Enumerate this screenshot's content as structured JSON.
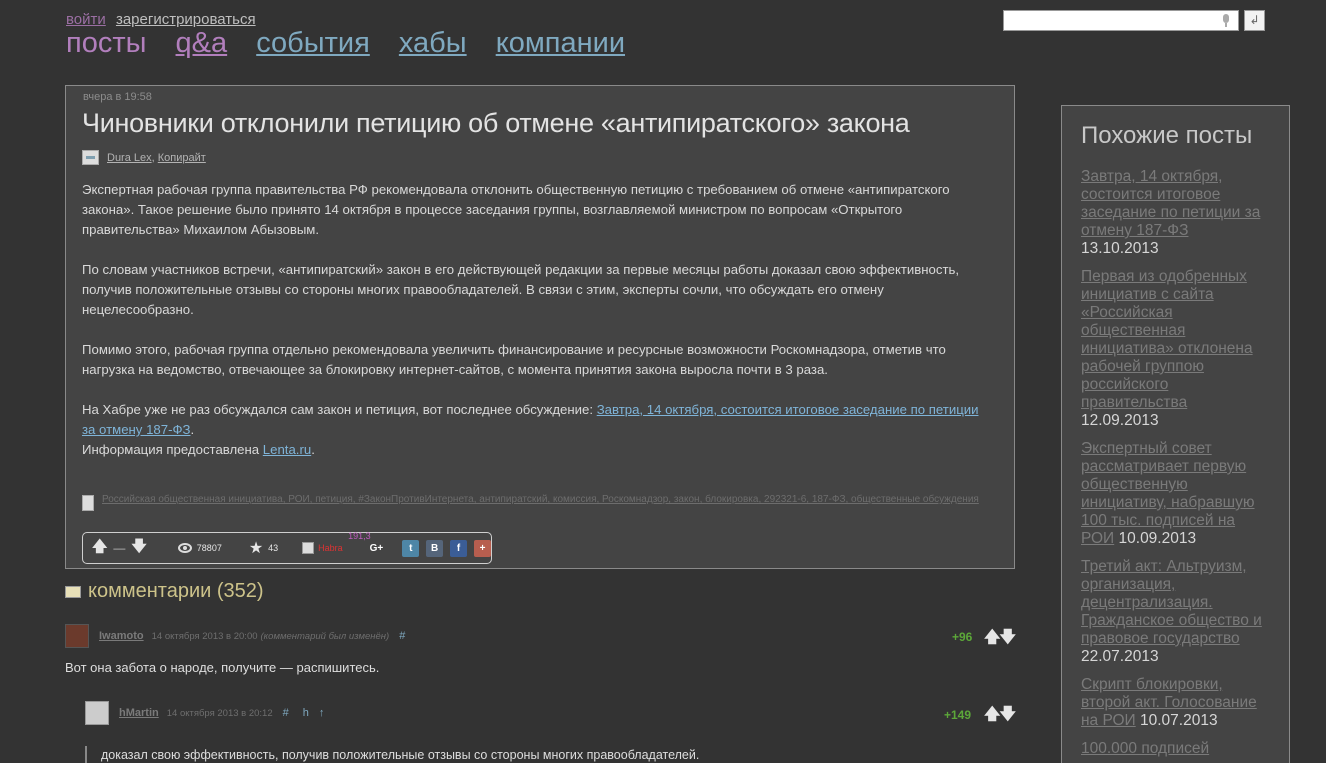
{
  "header": {
    "login": "войти",
    "register": "зарегистрироваться",
    "nav": [
      "посты",
      "q&a",
      "события",
      "хабы",
      "компании"
    ],
    "search_placeholder": "",
    "search_button": "↲"
  },
  "post": {
    "date": "вчера в 19:58",
    "title": "Чиновники отклонили петицию об отмене «антипиратского» закона",
    "hubs": [
      "Dura Lex",
      "Копирайт"
    ],
    "paragraphs": [
      "Экспертная рабочая группа правительства РФ рекомендовала отклонить общественную петицию с требованием об отмене «антипиратского закона». Такое решение было принято 14 октября в процессе заседания группы, возглавляемой министром по вопросам «Открытого правительства» Михаилом Абызовым.",
      "По словам участников встречи, «антипиратский» закон в его действующей редакции за первые месяцы работы доказал свою эффективность, получив положительные отзывы со стороны многих правообладателей. В связи с этим, эксперты сочли, что обсуждать его отмену нецелесообразно.",
      "Помимо этого, рабочая группа отдельно рекомендовала увеличить финансирование и ресурсные возможности Роскомнадзора, отметив что нагрузка на ведомство, отвечающее за блокировку интернет-сайтов, с момента принятия закона выросла почти в 3 раза."
    ],
    "last_text": "На Хабре уже не раз обсуждался сам закон и петиция, вот последнее обсуждение: ",
    "last_link": "Завтра, 14 октября, состоится итоговое заседание по петиции за отмену 187-ФЗ",
    "last_dot": ".",
    "info_text": "Информация предоставлена ",
    "info_link": "Lenta.ru",
    "info_dot": ".",
    "tags": "Российская общественная инициатива, РОИ, петиция, #ЗаконПротивИнтернета, антипиратский, комиссия, Роскомнадзор, закон, блокировка, 292321-6, 187-ФЗ, общественные обсуждения",
    "infobar": {
      "vote_up": "🡅",
      "vote_score": "—",
      "vote_down": "🡇",
      "views": "78807",
      "favorites": "43",
      "habra": "Habra",
      "karma": "191,3",
      "gplus": "G+",
      "share_tw": "t",
      "share_vk": "В",
      "share_fb": "f",
      "share_plus": "+"
    }
  },
  "comments": {
    "title": "комментарии (352)",
    "items": [
      {
        "user": "Iwamoto",
        "date": "14 октября 2013 в 20:00",
        "edited": "(комментарий был изменён)",
        "hash": "#",
        "score": "+96",
        "text": "Вот она забота о народе, получите — распишитесь."
      },
      {
        "user": "hMartin",
        "date": "14 октября 2013 в 20:12",
        "hash": "#",
        "parent": "h",
        "up": "↑",
        "score": "+149",
        "quote": "доказал свою эффективность, получив положительные отзывы со стороны многих правообладателей."
      }
    ],
    "arrows": "🡅🡇"
  },
  "sidebar": {
    "title": "Похожие посты",
    "items": [
      {
        "link": "Завтра, 14 октября, состоится итоговое заседание по петиции за отмену 187-ФЗ",
        "date": "13.10.2013"
      },
      {
        "link": "Первая из одобренных инициатив с сайта «Российская общественная инициатива» отклонена рабочей группою российского правительства",
        "date": "12.09.2013"
      },
      {
        "link": "Экспертный совет рассматривает первую общественную инициативу, набравшую 100 тыс. подписей на РОИ",
        "date": "10.09.2013"
      },
      {
        "link": "Третий акт: Альтруизм, организация, децентрализация. Гражданское общество и правовое государство",
        "date": "22.07.2013"
      },
      {
        "link": "Скрипт блокировки, второй акт. Голосование на РОИ",
        "date": "10.07.2013"
      },
      {
        "link": "100.000 подписей",
        "date": ""
      }
    ]
  }
}
